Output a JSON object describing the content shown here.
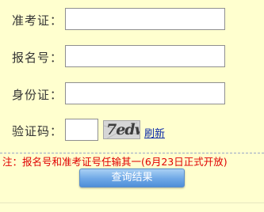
{
  "form": {
    "fields": [
      {
        "label": "准考证：",
        "value": "",
        "placeholder": ""
      },
      {
        "label": "报名号：",
        "value": "",
        "placeholder": ""
      },
      {
        "label": "身份证：",
        "value": "",
        "placeholder": ""
      }
    ],
    "captcha": {
      "label": "验证码：",
      "value": "",
      "image_text": "7edw",
      "refresh_label": "刷新"
    },
    "notice": "注：报名号和准考证号任输其一(6月23日正式开放)",
    "submit_label": "查询结果"
  },
  "colors": {
    "background": "#ffffcf",
    "notice": "#e00000",
    "link": "#0b2aa8",
    "button": "#6ea7e6"
  }
}
